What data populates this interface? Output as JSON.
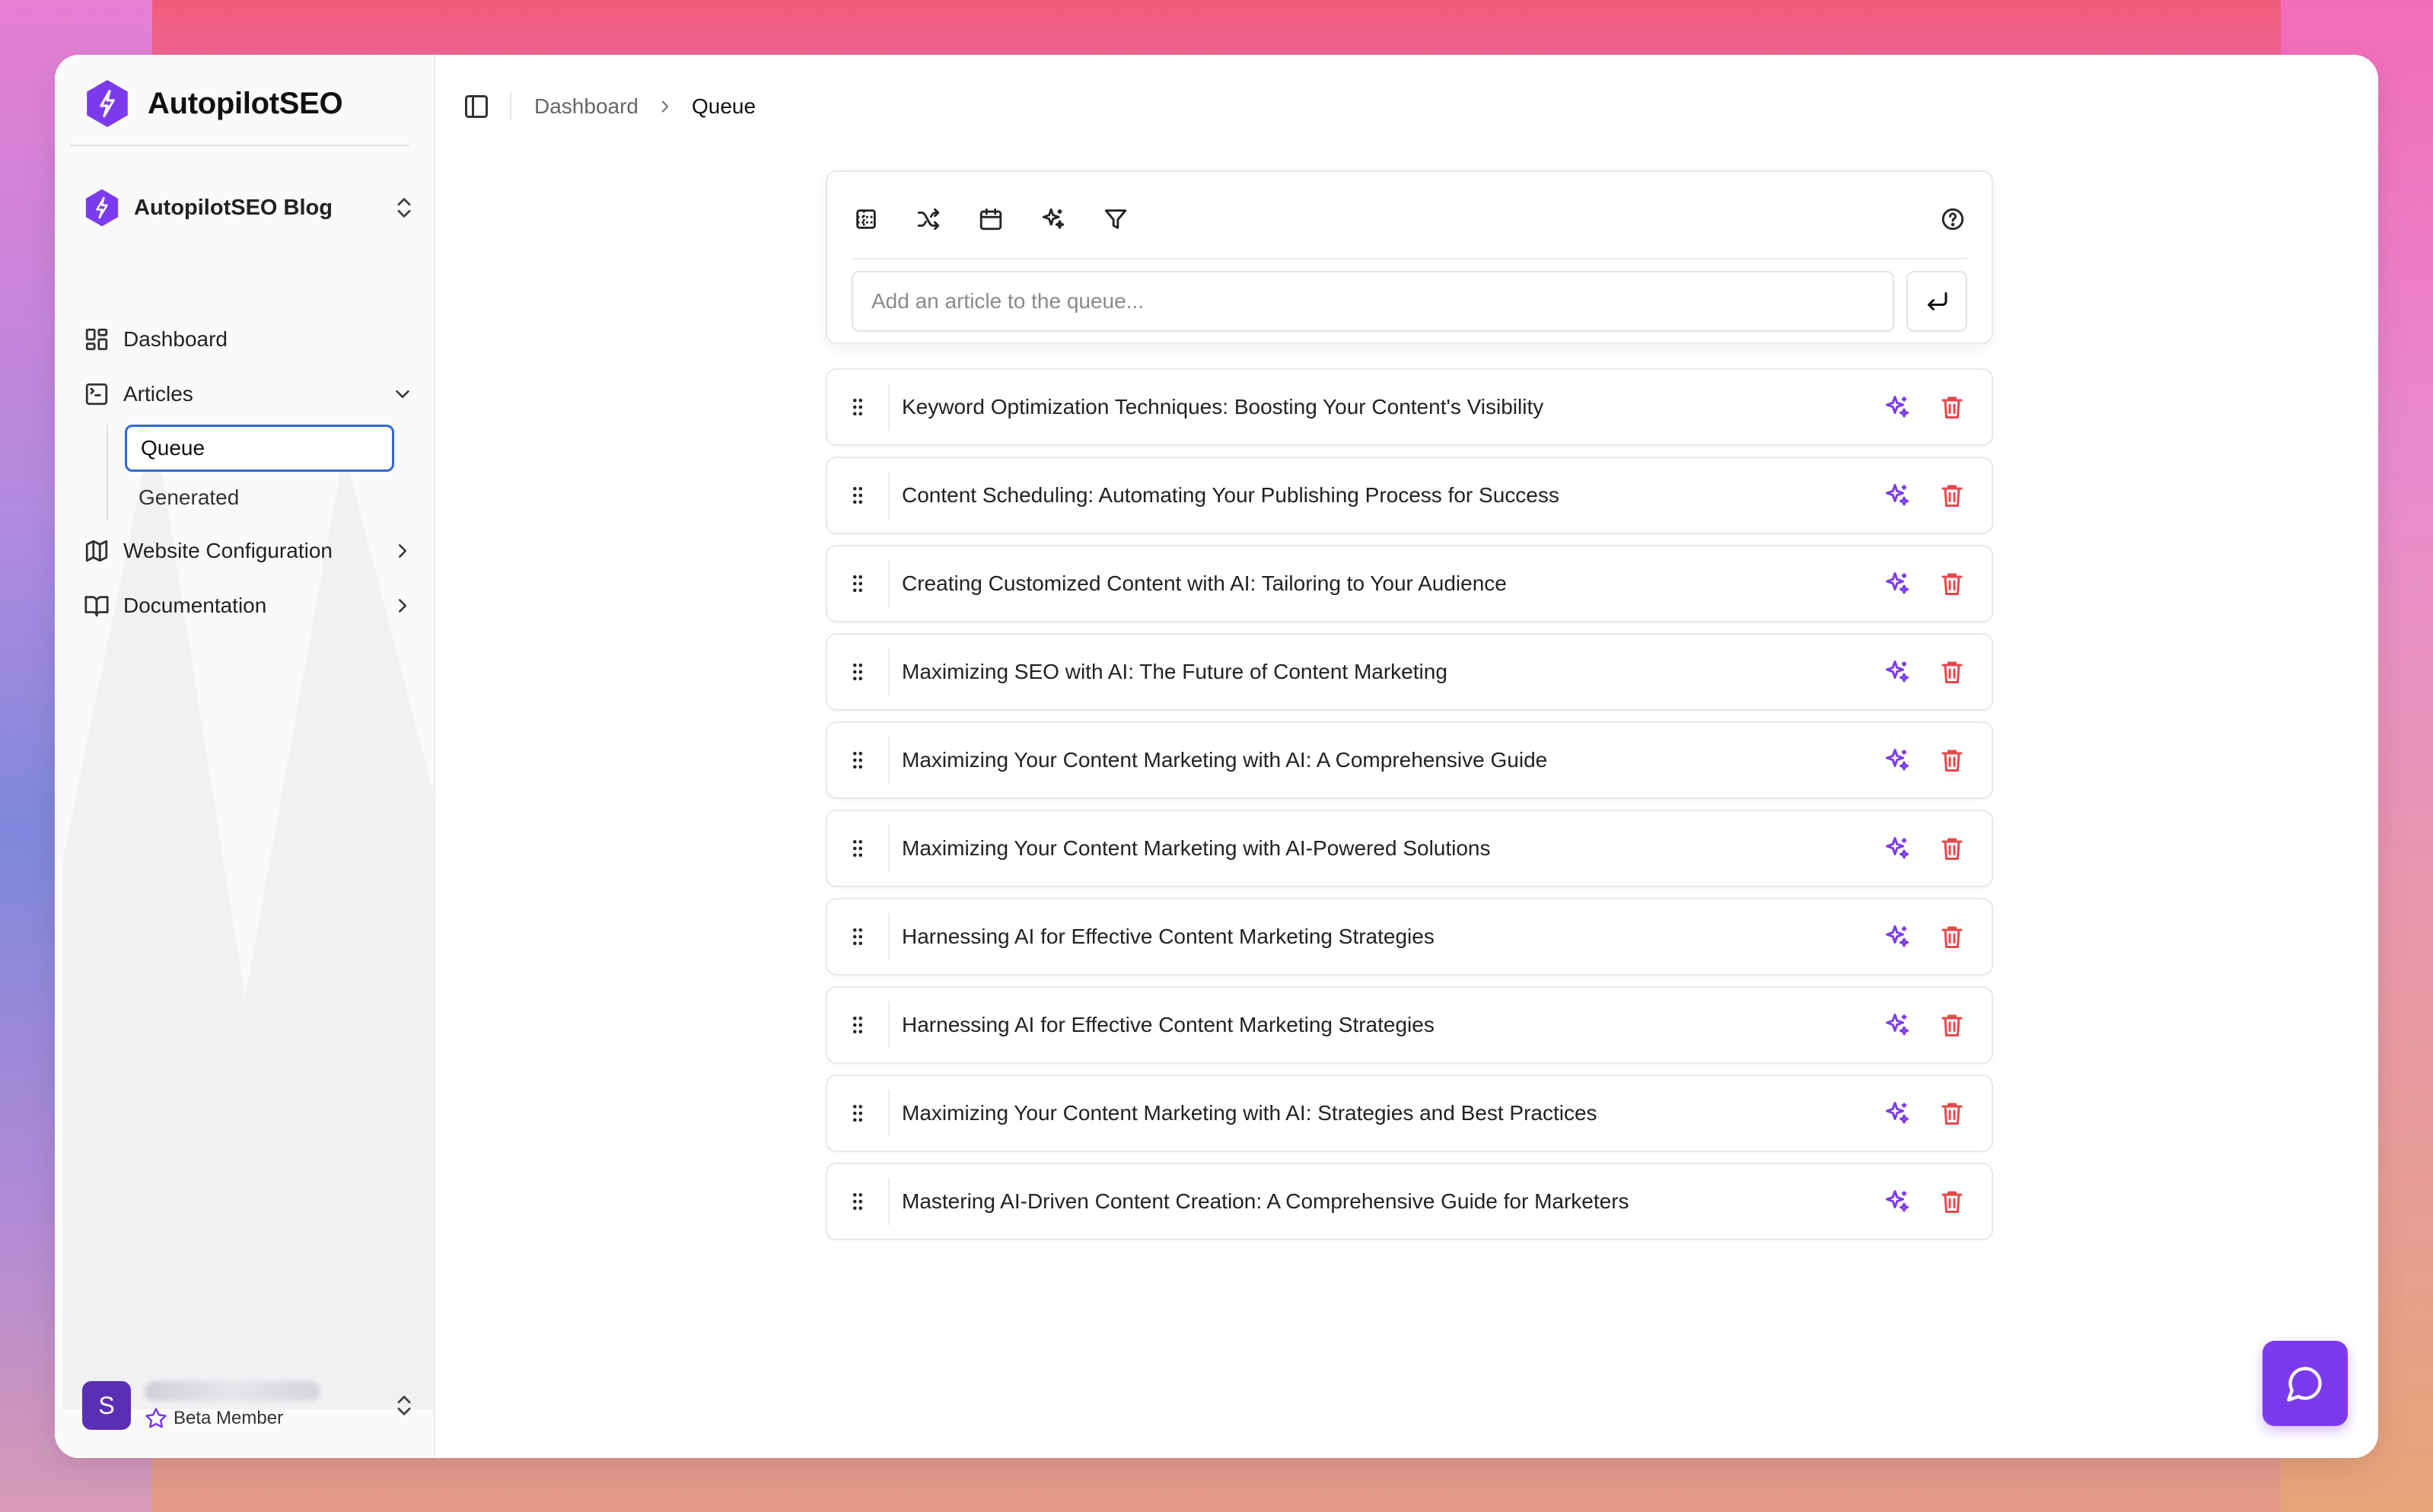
{
  "app": {
    "name": "AutopilotSEO"
  },
  "project": {
    "name": "AutopilotSEO Blog"
  },
  "nav": {
    "dashboard": "Dashboard",
    "articles": "Articles",
    "queue": "Queue",
    "generated": "Generated",
    "website_configuration": "Website Configuration",
    "documentation": "Documentation"
  },
  "user": {
    "initial": "S",
    "badge": "Beta Member"
  },
  "breadcrumb": {
    "parent": "Dashboard",
    "current": "Queue"
  },
  "composer": {
    "placeholder": "Add an article to the queue...",
    "tools": [
      "table-icon",
      "shuffle-icon",
      "calendar-icon",
      "sparkles-icon",
      "filter-icon"
    ],
    "help_icon": "help-circle-icon"
  },
  "queue": [
    "Keyword Optimization Techniques: Boosting Your Content's Visibility",
    "Content Scheduling: Automating Your Publishing Process for Success",
    "Creating Customized Content with AI: Tailoring to Your Audience",
    "Maximizing SEO with AI: The Future of Content Marketing",
    "Maximizing Your Content Marketing with AI: A Comprehensive Guide",
    "Maximizing Your Content Marketing with AI-Powered Solutions",
    "Harnessing AI for Effective Content Marketing Strategies",
    "Harnessing AI for Effective Content Marketing Strategies",
    "Maximizing Your Content Marketing with AI: Strategies and Best Practices",
    "Mastering AI-Driven Content Creation: A Comprehensive Guide for Marketers"
  ],
  "colors": {
    "accent": "#7c3aed",
    "danger": "#e5484d",
    "focus": "#2f6bd8"
  }
}
